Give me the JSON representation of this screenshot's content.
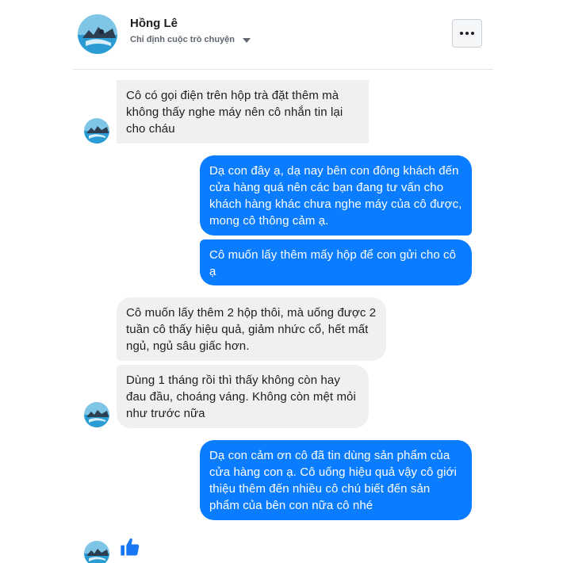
{
  "header": {
    "name": "Hồng Lê",
    "subtitle": "Chỉ định cuộc trò chuyện",
    "more_icon": "ellipsis-icon"
  },
  "messages": [
    {
      "side": "incoming",
      "text": "Cô có gọi điện trên hộp trà đặt thêm mà không thấy nghe máy nên cô nhắn tin lại cho cháu"
    },
    {
      "side": "outgoing",
      "text": "Dạ con đây ạ, dạ nay bên con đông khách đến cửa hàng quá nên các bạn đang tư vấn cho khách hàng khác chưa nghe máy của cô được, mong cô thông cảm ạ."
    },
    {
      "side": "outgoing",
      "text": "Cô muốn lấy thêm mấy hộp để con gửi cho cô ạ"
    },
    {
      "side": "incoming",
      "text": "Cô muốn lấy thêm 2 hộp thôi, mà uống được 2 tuần cô thấy hiệu quả, giảm nhức cổ, hết mất ngủ, ngủ sâu giấc hơn."
    },
    {
      "side": "incoming",
      "text": "Dùng 1 tháng rồi thì thấy không còn hay đau đầu, choáng váng. Không còn mệt mỏi như trước nữa"
    },
    {
      "side": "outgoing",
      "text": "Dạ con cảm ơn cô đã tin dùng sản phẩm của cửa hàng con ạ. Cô uống hiệu quả vậy cô giới thiệu thêm đến nhiều cô chú biết đến sản phẩm của bên con nữa cô nhé"
    }
  ],
  "composer": {
    "like_icon": "thumbs-up-icon"
  },
  "colors": {
    "outgoing_bubble": "#0a7cff",
    "incoming_bubble": "#f1f0f0",
    "like": "#1877f2"
  }
}
